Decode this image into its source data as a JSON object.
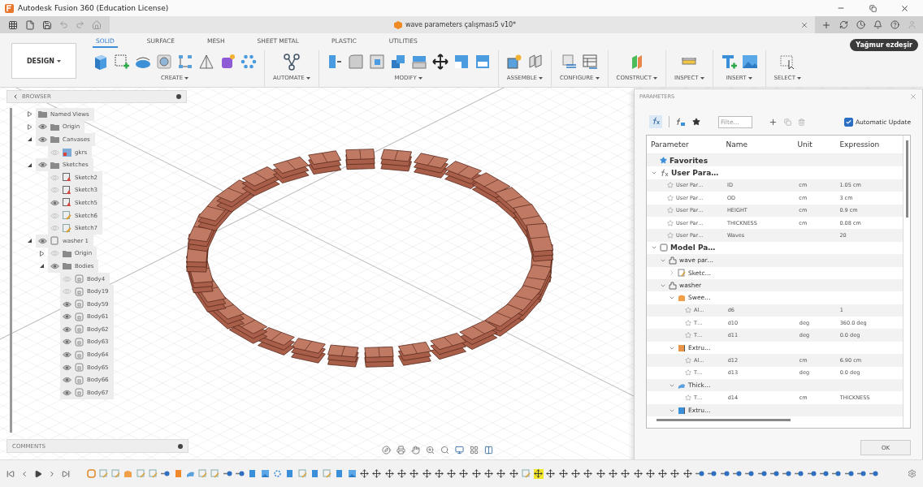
{
  "window": {
    "title": "Autodesk Fusion 360 (Education License)"
  },
  "document_tab": {
    "title": "wave parameters çalışması5 v10*"
  },
  "workspace_button": {
    "label": "DESIGN"
  },
  "toolbar_tabs": [
    {
      "label": "SOLID",
      "selected": true
    },
    {
      "label": "SURFACE",
      "selected": false
    },
    {
      "label": "MESH",
      "selected": false
    },
    {
      "label": "SHEET METAL",
      "selected": false
    },
    {
      "label": "PLASTIC",
      "selected": false
    },
    {
      "label": "UTILITIES",
      "selected": false
    }
  ],
  "toolbar_groups": [
    {
      "label": "CREATE"
    },
    {
      "label": "AUTOMATE"
    },
    {
      "label": "MODIFY"
    },
    {
      "label": "ASSEMBLE"
    },
    {
      "label": "CONFIGURE"
    },
    {
      "label": "CONSTRUCT"
    },
    {
      "label": "INSPECT"
    },
    {
      "label": "INSERT"
    },
    {
      "label": "SELECT"
    }
  ],
  "tooltip": {
    "text": "Yağmur ezdeşir"
  },
  "browser": {
    "title": "BROWSER",
    "items": [
      {
        "label": "Named Views",
        "kind": "folder",
        "expanded": false
      },
      {
        "label": "Origin",
        "kind": "folder",
        "expanded": false,
        "visible": true
      },
      {
        "label": "Canvases",
        "kind": "folder",
        "expanded": true,
        "visible": true,
        "children": [
          {
            "label": "gkrs",
            "kind": "canvas",
            "visible": false
          }
        ]
      },
      {
        "label": "Sketches",
        "kind": "folder",
        "expanded": true,
        "visible": true,
        "children": [
          {
            "label": "Sketch2",
            "kind": "sketch",
            "visible": false
          },
          {
            "label": "Sketch3",
            "kind": "sketch",
            "visible": false
          },
          {
            "label": "Sketch5",
            "kind": "sketch",
            "visible": true
          },
          {
            "label": "Sketch6",
            "kind": "sketch_edit",
            "visible": false
          },
          {
            "label": "Sketch7",
            "kind": "sketch_edit",
            "visible": false
          }
        ]
      },
      {
        "label": "washer 1",
        "kind": "component",
        "expanded": true,
        "visible": true,
        "children": [
          {
            "label": "Origin",
            "kind": "folder",
            "expanded": false,
            "visible": false
          },
          {
            "label": "Bodies",
            "kind": "folder",
            "expanded": true,
            "visible": true,
            "children": [
              {
                "label": "Body4",
                "kind": "body",
                "visible": false
              },
              {
                "label": "Body19",
                "kind": "body",
                "visible": false
              },
              {
                "label": "Body59",
                "kind": "body",
                "visible": true
              },
              {
                "label": "Body61",
                "kind": "body",
                "visible": true
              },
              {
                "label": "Body62",
                "kind": "body",
                "visible": true
              },
              {
                "label": "Body63",
                "kind": "body",
                "visible": true
              },
              {
                "label": "Body64",
                "kind": "body",
                "visible": true
              },
              {
                "label": "Body65",
                "kind": "body",
                "visible": true
              },
              {
                "label": "Body66",
                "kind": "body",
                "visible": true
              },
              {
                "label": "Body67",
                "kind": "body",
                "visible": true
              }
            ]
          }
        ]
      }
    ]
  },
  "comments": {
    "title": "COMMENTS"
  },
  "parameters": {
    "title": "PARAMETERS",
    "filter": {
      "placeholder": "Filte..."
    },
    "auto_update": {
      "label": "Automatic Update",
      "checked": true
    },
    "columns": [
      "Parameter",
      "Name",
      "Unit",
      "Expression"
    ],
    "rows": [
      {
        "kind": "favorites",
        "label": "Favorites"
      },
      {
        "kind": "user",
        "label": "User Para…",
        "expanded": true,
        "children": [
          {
            "kind": "param",
            "favorite": false,
            "parameter": "User Par…",
            "name": "ID",
            "unit": "cm",
            "expression": "1.05 cm"
          },
          {
            "kind": "param",
            "favorite": false,
            "parameter": "User Par…",
            "name": "OD",
            "unit": "cm",
            "expression": "3 cm"
          },
          {
            "kind": "param",
            "favorite": false,
            "parameter": "User Par…",
            "name": "HEIGHT",
            "unit": "cm",
            "expression": "0.9 cm"
          },
          {
            "kind": "param",
            "favorite": false,
            "parameter": "User Par…",
            "name": "THICKNESS",
            "unit": "cm",
            "expression": "0.08 cm"
          },
          {
            "kind": "param",
            "favorite": false,
            "parameter": "User Par…",
            "name": "Waves",
            "expression": "20"
          }
        ]
      },
      {
        "kind": "model",
        "label": "Model Pa…",
        "expanded": true,
        "children": [
          {
            "kind": "component",
            "label": "wave par…",
            "expanded": true,
            "children": [
              {
                "kind": "sketch",
                "label": "Sketc…",
                "expanded": false
              }
            ]
          },
          {
            "kind": "component",
            "label": "washer",
            "expanded": true,
            "children": [
              {
                "kind": "sweep",
                "label": "Swee…",
                "expanded": true,
                "children": [
                  {
                    "kind": "param",
                    "favorite": false,
                    "parameter": "Al…",
                    "name": "d6",
                    "expression": "1"
                  },
                  {
                    "kind": "param",
                    "favorite": false,
                    "parameter": "T…",
                    "name": "d10",
                    "unit": "deg",
                    "expression": "360.0 deg"
                  },
                  {
                    "kind": "param",
                    "favorite": false,
                    "parameter": "T…",
                    "name": "d11",
                    "unit": "deg",
                    "expression": "0.0 deg"
                  }
                ]
              },
              {
                "kind": "extrude",
                "color": "#e8944a",
                "label": "Extru…",
                "expanded": true,
                "children": [
                  {
                    "kind": "param",
                    "favorite": false,
                    "parameter": "Al…",
                    "name": "d12",
                    "unit": "cm",
                    "expression": "6.90 cm"
                  },
                  {
                    "kind": "param",
                    "favorite": false,
                    "parameter": "T…",
                    "name": "d13",
                    "unit": "deg",
                    "expression": "0.0 deg"
                  }
                ]
              },
              {
                "kind": "thicken",
                "label": "Thick…",
                "expanded": true,
                "children": [
                  {
                    "kind": "param",
                    "favorite": false,
                    "parameter": "T…",
                    "name": "d14",
                    "unit": "cm",
                    "expression": "THICKNESS"
                  }
                ]
              },
              {
                "kind": "extrude",
                "color": "#3a8fd8",
                "label": "Extru…",
                "expanded": true
              }
            ]
          }
        ]
      }
    ],
    "ok_button": {
      "label": "OK"
    }
  },
  "timeline": {
    "items": [
      {
        "kind": "component",
        "selected": false
      },
      {
        "kind": "sketch",
        "selected": false
      },
      {
        "kind": "sketch",
        "selected": false
      },
      {
        "kind": "sweep",
        "selected": false
      },
      {
        "kind": "sketch",
        "selected": false
      },
      {
        "kind": "sketch",
        "selected": false
      },
      {
        "kind": "joint",
        "selected": false
      },
      {
        "kind": "extrude",
        "selected": false
      },
      {
        "kind": "thicken",
        "selected": false
      },
      {
        "kind": "sketch",
        "selected": false
      },
      {
        "kind": "sketch",
        "selected": false
      },
      {
        "kind": "joint",
        "selected": false
      },
      {
        "kind": "joint",
        "selected": false
      },
      {
        "kind": "body",
        "selected": false
      },
      {
        "kind": "canvas",
        "selected": false
      },
      {
        "kind": "pattern",
        "selected": false
      },
      {
        "kind": "body",
        "selected": false
      },
      {
        "kind": "sketch",
        "selected": false
      },
      {
        "kind": "body",
        "selected": false
      },
      {
        "kind": "sketch",
        "selected": false
      },
      {
        "kind": "body",
        "selected": false
      },
      {
        "kind": "canvas",
        "selected": false
      },
      {
        "kind": "move",
        "selected": false
      },
      {
        "kind": "move",
        "selected": false
      },
      {
        "kind": "move",
        "selected": false
      },
      {
        "kind": "move",
        "selected": false
      },
      {
        "kind": "move",
        "selected": false
      },
      {
        "kind": "move",
        "selected": false
      },
      {
        "kind": "move",
        "selected": false
      },
      {
        "kind": "move",
        "selected": false
      },
      {
        "kind": "move",
        "selected": false
      },
      {
        "kind": "move",
        "selected": false
      },
      {
        "kind": "move",
        "selected": false
      },
      {
        "kind": "move",
        "selected": false
      },
      {
        "kind": "move",
        "selected": false
      },
      {
        "kind": "sketch",
        "selected": false
      },
      {
        "kind": "move",
        "selected": true
      },
      {
        "kind": "move",
        "selected": false
      },
      {
        "kind": "move",
        "selected": false
      },
      {
        "kind": "move",
        "selected": false
      },
      {
        "kind": "move",
        "selected": false
      },
      {
        "kind": "move",
        "selected": false
      },
      {
        "kind": "move",
        "selected": false
      },
      {
        "kind": "move",
        "selected": false
      },
      {
        "kind": "move",
        "selected": false
      },
      {
        "kind": "move",
        "selected": false
      },
      {
        "kind": "move",
        "selected": false
      },
      {
        "kind": "move",
        "selected": false
      },
      {
        "kind": "move",
        "selected": false
      },
      {
        "kind": "joint",
        "selected": false
      },
      {
        "kind": "joint",
        "selected": false
      },
      {
        "kind": "joint",
        "selected": false
      },
      {
        "kind": "joint",
        "selected": false
      },
      {
        "kind": "joint",
        "selected": false
      },
      {
        "kind": "joint",
        "selected": false
      },
      {
        "kind": "joint",
        "selected": false
      },
      {
        "kind": "joint",
        "selected": false
      },
      {
        "kind": "joint",
        "selected": false
      },
      {
        "kind": "joint",
        "selected": false
      },
      {
        "kind": "joint",
        "selected": false
      },
      {
        "kind": "joint",
        "selected": false
      },
      {
        "kind": "joint",
        "selected": false
      },
      {
        "kind": "joint",
        "selected": false
      },
      {
        "kind": "joint",
        "selected": false
      }
    ]
  }
}
